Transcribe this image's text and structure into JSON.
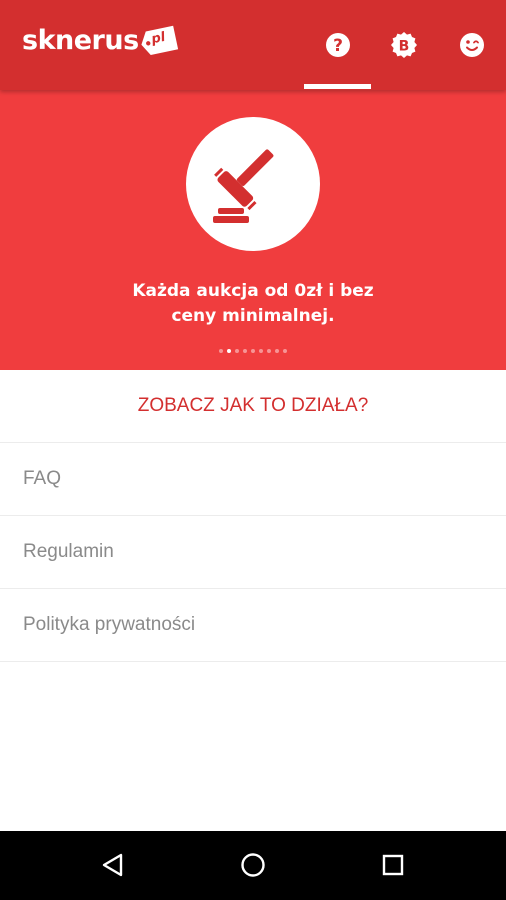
{
  "app": {
    "logo_text": "sknerus",
    "logo_tag": "pl"
  },
  "header": {
    "tabs": [
      {
        "icon": "help-icon",
        "glyph": "?",
        "active": true
      },
      {
        "icon": "badge-b-icon",
        "glyph": "B",
        "active": false
      },
      {
        "icon": "smiley-icon",
        "active": false
      }
    ]
  },
  "hero": {
    "icon": "gavel-icon",
    "line1": "Każda aukcja od 0zł i bez",
    "line2": "ceny minimalnej.",
    "pager": {
      "total": 9,
      "current": 2
    }
  },
  "how_it_works": {
    "label": "ZOBACZ JAK TO DZIAŁA?"
  },
  "menu": {
    "items": [
      {
        "label": "FAQ"
      },
      {
        "label": "Regulamin"
      },
      {
        "label": "Polityka prywatności"
      }
    ]
  },
  "system_nav": {
    "buttons": [
      "back-icon",
      "home-icon",
      "recents-icon"
    ]
  },
  "colors": {
    "appbar": "#d32f2f",
    "hero": "#f03d3e",
    "accent_text": "#d32f2f",
    "menu_text": "#8a8a8a"
  }
}
